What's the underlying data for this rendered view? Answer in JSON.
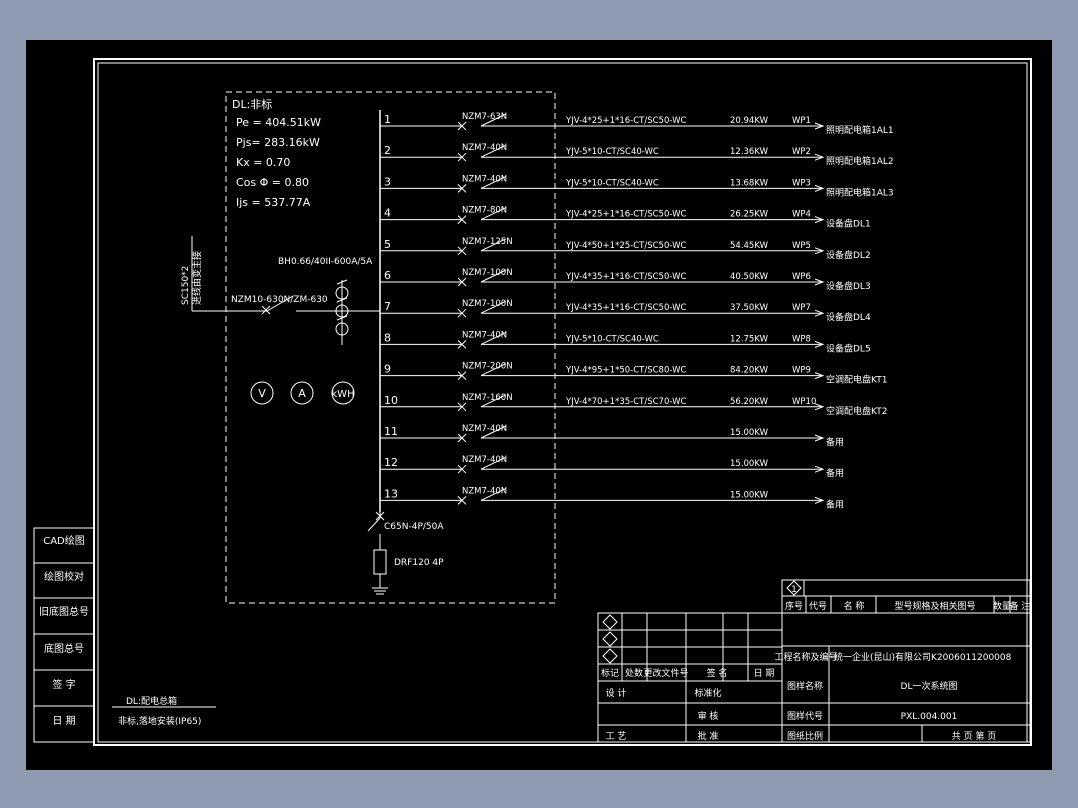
{
  "colors": {
    "background": "#8e9ab0",
    "canvas": "#000000",
    "line": "#ffffff"
  },
  "board": {
    "title": "DL:非标",
    "params": [
      "Pe = 404.51kW",
      "Pjs= 283.16kW",
      "Kx = 0.70",
      "Cos Φ = 0.80",
      "Ijs = 537.77A"
    ]
  },
  "incoming": {
    "cable_line1": "SC150*2",
    "cable_line2": "进线由变主接",
    "breaker": "NZM10-630N/ZM-630",
    "ct": "BH0.66/40II-600A/5A"
  },
  "meters": [
    "V",
    "A",
    "kWH"
  ],
  "feeders": [
    {
      "num": "1",
      "breaker": "NZM7-63N",
      "cable": "YJV-4*25+1*16-CT/SC50-WC",
      "power": "20.94KW",
      "code": "WP1",
      "dest": "照明配电箱1AL1"
    },
    {
      "num": "2",
      "breaker": "NZM7-40N",
      "cable": "YJV-5*10-CT/SC40-WC",
      "power": "12.36KW",
      "code": "WP2",
      "dest": "照明配电箱1AL2"
    },
    {
      "num": "3",
      "breaker": "NZM7-40N",
      "cable": "YJV-5*10-CT/SC40-WC",
      "power": "13.68KW",
      "code": "WP3",
      "dest": "照明配电箱1AL3"
    },
    {
      "num": "4",
      "breaker": "NZM7-80N",
      "cable": "YJV-4*25+1*16-CT/SC50-WC",
      "power": "26.25KW",
      "code": "WP4",
      "dest": "设备盘DL1"
    },
    {
      "num": "5",
      "breaker": "NZM7-125N",
      "cable": "YJV-4*50+1*25-CT/SC50-WC",
      "power": "54.45KW",
      "code": "WP5",
      "dest": "设备盘DL2"
    },
    {
      "num": "6",
      "breaker": "NZM7-100N",
      "cable": "YJV-4*35+1*16-CT/SC50-WC",
      "power": "40.50KW",
      "code": "WP6",
      "dest": "设备盘DL3"
    },
    {
      "num": "7",
      "breaker": "NZM7-100N",
      "cable": "YJV-4*35+1*16-CT/SC50-WC",
      "power": "37.50KW",
      "code": "WP7",
      "dest": "设备盘DL4"
    },
    {
      "num": "8",
      "breaker": "NZM7-40N",
      "cable": "YJV-5*10-CT/SC40-WC",
      "power": "12.75KW",
      "code": "WP8",
      "dest": "设备盘DL5"
    },
    {
      "num": "9",
      "breaker": "NZM7-200N",
      "cable": "YJV-4*95+1*50-CT/SC80-WC",
      "power": "84.20KW",
      "code": "WP9",
      "dest": "空调配电盘KT1"
    },
    {
      "num": "10",
      "breaker": "NZM7-160N",
      "cable": "YJV-4*70+1*35-CT/SC70-WC",
      "power": "56.20KW",
      "code": "WP10",
      "dest": "空调配电盘KT2"
    },
    {
      "num": "11",
      "breaker": "NZM7-40N",
      "cable": "",
      "power": "15.00KW",
      "code": "",
      "dest": "备用"
    },
    {
      "num": "12",
      "breaker": "NZM7-40N",
      "cable": "",
      "power": "15.00KW",
      "code": "",
      "dest": "备用"
    },
    {
      "num": "13",
      "breaker": "NZM7-40N",
      "cable": "",
      "power": "15.00KW",
      "code": "",
      "dest": "备用"
    }
  ],
  "spd": {
    "breaker": "C65N-4P/50A",
    "device": "DRF120 4P"
  },
  "note": {
    "line1": "DL:配电总箱",
    "line2": "非标,落地安装(IP65)"
  },
  "left_strip": [
    "CAD绘图",
    "绘图校对",
    "旧底图总号",
    "底图总号",
    "签 字",
    "日 期"
  ],
  "title_block": {
    "rev_marker": "1",
    "parts_header": [
      "序号",
      "代号",
      "名 称",
      "型号规格及相关图号",
      "数量",
      "备 注"
    ],
    "rev_header": [
      "标记",
      "处数",
      "更改文件号",
      "签 名",
      "日 期"
    ],
    "roles": [
      "设 计",
      "工 艺"
    ],
    "roles2": [
      "标准化",
      "审 核",
      "批 准"
    ],
    "company_label": "工程名称及编号",
    "company": "统一企业(昆山)有限公司K2006011200008",
    "name_label": "图样名称",
    "name": "DL一次系统图",
    "code_label": "图样代号",
    "code": "PXL.004.001",
    "scale_label": "图纸比例",
    "pages": "共  页  第  页"
  }
}
